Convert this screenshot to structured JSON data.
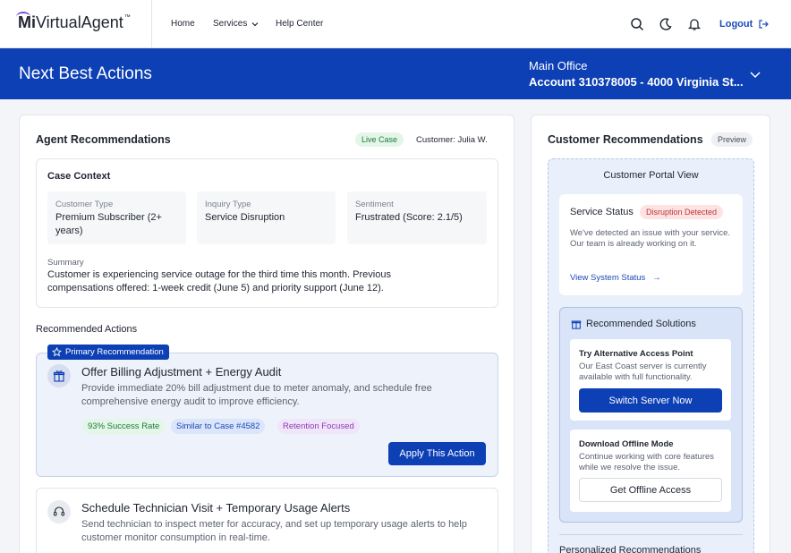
{
  "brand": {
    "mi": "Mi",
    "rest": "VirtualAgent",
    "tm": "™"
  },
  "nav": {
    "home": "Home",
    "services": "Services",
    "help": "Help Center",
    "logout": "Logout"
  },
  "banner": {
    "title": "Next Best Actions",
    "office": "Main Office",
    "account": "Account 310378005 - 4000 Virginia St..."
  },
  "agent": {
    "title": "Agent Recommendations",
    "live_badge": "Live Case",
    "customer_label": "Customer: Julia W.",
    "context": {
      "title": "Case Context",
      "customer_type_label": "Customer Type",
      "customer_type_value": "Premium Subscriber (2+ years)",
      "inquiry_type_label": "Inquiry Type",
      "inquiry_type_value": "Service Disruption",
      "sentiment_label": "Sentiment",
      "sentiment_value": "Frustrated (Score: 2.1/5)",
      "summary_label": "Summary",
      "summary_text": "Customer is experiencing service outage for the third time this month. Previous compensations offered: 1-week credit (June 5) and priority support (June 12)."
    },
    "recommended_title": "Recommended Actions",
    "primary": {
      "badge": "Primary Recommendation",
      "title": "Offer Billing Adjustment + Energy Audit",
      "desc": "Provide immediate 20% bill adjustment due to meter anomaly, and schedule free comprehensive energy audit to improve efficiency.",
      "tags": [
        "93% Success Rate",
        "Similar to Case #4582",
        "Retention Focused"
      ],
      "button": "Apply This Action"
    },
    "secondary": {
      "title": "Schedule Technician Visit + Temporary Usage Alerts",
      "desc": "Send technician to inspect meter for accuracy, and set up temporary usage alerts to help customer monitor consumption in real-time."
    }
  },
  "customer": {
    "title": "Customer Recommendations",
    "preview": "Preview",
    "portal_title": "Customer Portal View",
    "service_status_label": "Service Status",
    "disruption_badge": "Disruption Detected",
    "status_text": "We've detected an issue with your service. Our team is already working on it.",
    "status_link": "View System Status",
    "solutions_title": "Recommended Solutions",
    "alt_title": "Try Alternative Access Point",
    "alt_text": "Our East Coast server is currently available with full functionality.",
    "alt_button": "Switch Server Now",
    "offline_title": "Download Offline Mode",
    "offline_text": "Continue working with core features while we resolve the issue.",
    "offline_button": "Get Offline Access",
    "personalized_title": "Personalized Recommendations"
  },
  "colors": {
    "primary": "#0d40b5",
    "live_green": "#e3f6e8",
    "danger_bg": "#fde3e3",
    "portal_bg": "#e9f0fb"
  }
}
